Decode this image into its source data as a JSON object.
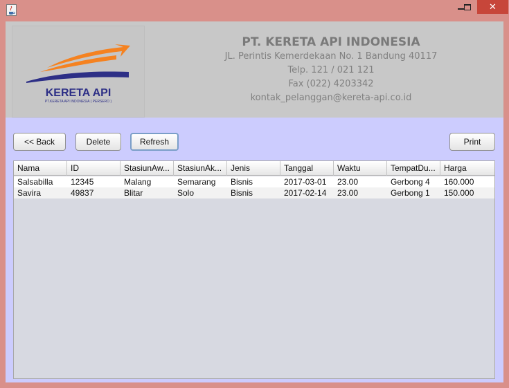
{
  "window": {
    "icon": "java-cup-icon",
    "close_glyph": "✕"
  },
  "header": {
    "logo": {
      "title": "KERETA API",
      "subtitle": "PT.KERETA API INDONESIA ( PERSERO )",
      "colors": {
        "orange": "#f58220",
        "navy": "#2d2f86"
      }
    },
    "company_name": "PT. KERETA API INDONESIA",
    "address": "JL. Perintis Kemerdekaan No. 1 Bandung 40117",
    "phone": "Telp. 121 / 021 121",
    "fax": "Fax (022) 4203342",
    "email": "kontak_pelanggan@kereta-api.co.id"
  },
  "toolbar": {
    "back_label": "<< Back",
    "delete_label": "Delete",
    "refresh_label": "Refresh",
    "print_label": "Print"
  },
  "table": {
    "columns": [
      "Nama",
      "ID",
      "StasiunAw...",
      "StasiunAk...",
      "Jenis",
      "Tanggal",
      "Waktu",
      "TempatDu...",
      "Harga"
    ],
    "rows": [
      [
        "Salsabilla",
        "12345",
        "Malang",
        "Semarang",
        "Bisnis",
        "2017-03-01",
        "23.00",
        "Gerbong 4",
        "160.000"
      ],
      [
        "Savira",
        "49837",
        "Blitar",
        "Solo",
        "Bisnis",
        "2017-02-14",
        "23.00",
        "Gerbong 1",
        "150.000"
      ]
    ]
  },
  "colors": {
    "window_frame": "#d9908a",
    "content_bg": "#ccccfe",
    "header_bg": "#c8c8c8",
    "close_button": "#c7463a",
    "table_bg": "#d7d9e1"
  }
}
